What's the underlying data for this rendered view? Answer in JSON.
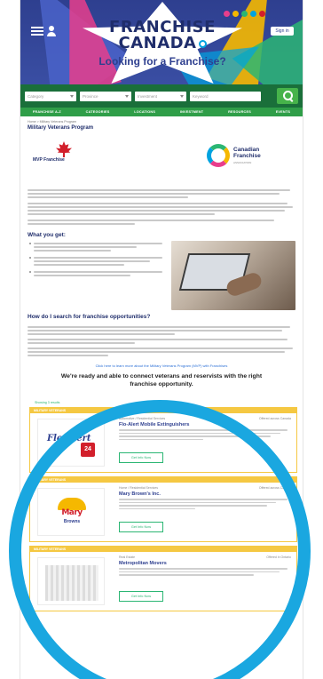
{
  "header": {
    "brand_line1": "FRANCHISE",
    "brand_line2": "CANADA",
    "tagline": "Looking for a Franchise?",
    "signin_label": "Sign in",
    "social_colors": [
      "#e83e8c",
      "#f5b800",
      "#2bb673",
      "#00a3e0",
      "#d21f2b"
    ]
  },
  "search": {
    "fields": [
      "Category",
      "Province",
      "Investment",
      "Keyword"
    ],
    "button_icon": "search-icon"
  },
  "nav": {
    "items": [
      "FRANCHISE A-Z",
      "CATEGORIES",
      "LOCATIONS",
      "INVESTMENT",
      "RESOURCES",
      "EVENTS"
    ]
  },
  "page": {
    "breadcrumb": "Home > Military Veterans Program",
    "title": "Military Veterans Program",
    "logo_left_text": "MVP Franchise",
    "logo_right_line1": "Canadian",
    "logo_right_line2": "Franchise",
    "logo_right_sub": "ASSOCIATION",
    "what_heading": "What you get:",
    "how_heading": "How do I search for franchise opportunities?",
    "cta_link": "Click here to learn more about the Military Veterans Program (MVP) with Franchises",
    "cta_heading": "We're ready and able to connect veterans and reservists with the right franchise opportunity.",
    "results_meta": "Showing 3 results"
  },
  "listings": [
    {
      "bar": "MILITARY VETERANS",
      "category": "Automotive / Residential Services",
      "location": "Offered across Canada",
      "name": "Flo-Alert Mobile Extinguishers",
      "logo_text": "Flo-Alert",
      "badge": "24",
      "button": "Get Info Now"
    },
    {
      "bar": "MILITARY VETERANS",
      "category": "Home / Residential Services",
      "location": "Offered across Canada",
      "name": "Mary Brown's Inc.",
      "logo_text": "Mary",
      "logo_text2": "Browns",
      "button": "Get Info Now"
    },
    {
      "bar": "MILITARY VETERANS",
      "category": "Real Estate",
      "location": "Offered in Ontario",
      "name": "Metropolitan Movers",
      "button": "Get Info Now"
    }
  ],
  "accent_colors": {
    "navy": "#1f2d6b",
    "green": "#2bb673",
    "gold": "#f5c842",
    "ring": "#1aa7e0"
  }
}
